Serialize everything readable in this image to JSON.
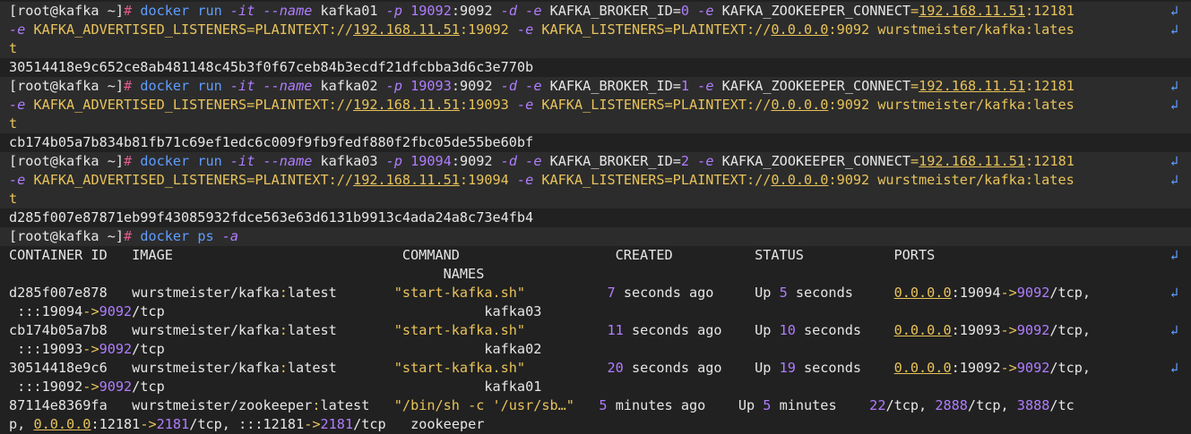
{
  "colors": {
    "background": "#212121",
    "band": "#2c2c2c",
    "text": "#e6e6e6",
    "prompt_hash": "#e05a8a",
    "command": "#5f9cff",
    "option": "#b07dff",
    "string": "#e8c35a"
  },
  "wrap_icon": "↲",
  "lines": [
    {
      "band": true,
      "wrap": true,
      "segments": [
        {
          "t": "[root@kafka ~]",
          "c": "prompt"
        },
        {
          "t": "# ",
          "c": "hash"
        },
        {
          "t": "docker run ",
          "c": "cmd"
        },
        {
          "t": "-it",
          "c": "opt"
        },
        {
          "t": " ",
          "c": "plain"
        },
        {
          "t": "--name",
          "c": "opt"
        },
        {
          "t": " kafka01 ",
          "c": "plain"
        },
        {
          "t": "-p",
          "c": "opt"
        },
        {
          "t": " ",
          "c": "plain"
        },
        {
          "t": "19092",
          "c": "num"
        },
        {
          "t": ":9092 ",
          "c": "plain"
        },
        {
          "t": "-d",
          "c": "opt"
        },
        {
          "t": " ",
          "c": "plain"
        },
        {
          "t": "-e",
          "c": "opt"
        },
        {
          "t": " KAFKA_BROKER_ID=",
          "c": "plain"
        },
        {
          "t": "0",
          "c": "num"
        },
        {
          "t": " ",
          "c": "plain"
        },
        {
          "t": "-e",
          "c": "opt"
        },
        {
          "t": " KAFKA_ZOOKEEPER_CONNECT",
          "c": "plain"
        },
        {
          "t": "=",
          "c": "op"
        },
        {
          "t": "192.168.11.51",
          "c": "ip"
        },
        {
          "t": ":12181",
          "c": "str"
        }
      ]
    },
    {
      "band": true,
      "wrap": true,
      "segments": [
        {
          "t": "-e",
          "c": "opt"
        },
        {
          "t": " KAFKA_ADVERTISED_LISTENERS=PLAINTEXT://",
          "c": "str"
        },
        {
          "t": "192.168.11.51",
          "c": "ip"
        },
        {
          "t": ":19092 ",
          "c": "str"
        },
        {
          "t": "-e",
          "c": "opt"
        },
        {
          "t": " KAFKA_LISTENERS=PLAINTEXT://",
          "c": "str"
        },
        {
          "t": "0.0.0.0",
          "c": "ip"
        },
        {
          "t": ":9092 wurstmeister/kafka:lates",
          "c": "str"
        }
      ]
    },
    {
      "band": true,
      "wrap": false,
      "segments": [
        {
          "t": "t",
          "c": "str"
        }
      ]
    },
    {
      "band": false,
      "wrap": false,
      "segments": [
        {
          "t": "30514418e9c652ce8ab481148c45b3f0f67ceb84b3ecdf21dfcbba3d6c3e770b",
          "c": "plain"
        }
      ]
    },
    {
      "band": true,
      "wrap": true,
      "segments": [
        {
          "t": "[root@kafka ~]",
          "c": "prompt"
        },
        {
          "t": "# ",
          "c": "hash"
        },
        {
          "t": "docker run ",
          "c": "cmd"
        },
        {
          "t": "-it",
          "c": "opt"
        },
        {
          "t": " ",
          "c": "plain"
        },
        {
          "t": "--name",
          "c": "opt"
        },
        {
          "t": " kafka02 ",
          "c": "plain"
        },
        {
          "t": "-p",
          "c": "opt"
        },
        {
          "t": " ",
          "c": "plain"
        },
        {
          "t": "19093",
          "c": "num"
        },
        {
          "t": ":9092 ",
          "c": "plain"
        },
        {
          "t": "-d",
          "c": "opt"
        },
        {
          "t": " ",
          "c": "plain"
        },
        {
          "t": "-e",
          "c": "opt"
        },
        {
          "t": " KAFKA_BROKER_ID=",
          "c": "plain"
        },
        {
          "t": "1",
          "c": "num"
        },
        {
          "t": " ",
          "c": "plain"
        },
        {
          "t": "-e",
          "c": "opt"
        },
        {
          "t": " KAFKA_ZOOKEEPER_CONNECT",
          "c": "plain"
        },
        {
          "t": "=",
          "c": "op"
        },
        {
          "t": "192.168.11.51",
          "c": "ip"
        },
        {
          "t": ":12181",
          "c": "str"
        }
      ]
    },
    {
      "band": true,
      "wrap": true,
      "segments": [
        {
          "t": "-e",
          "c": "opt"
        },
        {
          "t": " KAFKA_ADVERTISED_LISTENERS=PLAINTEXT://",
          "c": "str"
        },
        {
          "t": "192.168.11.51",
          "c": "ip"
        },
        {
          "t": ":19093 ",
          "c": "str"
        },
        {
          "t": "-e",
          "c": "opt"
        },
        {
          "t": " KAFKA_LISTENERS=PLAINTEXT://",
          "c": "str"
        },
        {
          "t": "0.0.0.0",
          "c": "ip"
        },
        {
          "t": ":9092 wurstmeister/kafka:lates",
          "c": "str"
        }
      ]
    },
    {
      "band": true,
      "wrap": false,
      "segments": [
        {
          "t": "t",
          "c": "str"
        }
      ]
    },
    {
      "band": false,
      "wrap": false,
      "segments": [
        {
          "t": "cb174b05a7b834b81fb71c69ef1edc6c009f9fb9fedf880f2fbc05de55be60bf",
          "c": "plain"
        }
      ]
    },
    {
      "band": true,
      "wrap": true,
      "segments": [
        {
          "t": "[root@kafka ~]",
          "c": "prompt"
        },
        {
          "t": "# ",
          "c": "hash"
        },
        {
          "t": "docker run ",
          "c": "cmd"
        },
        {
          "t": "-it",
          "c": "opt"
        },
        {
          "t": " ",
          "c": "plain"
        },
        {
          "t": "--name",
          "c": "opt"
        },
        {
          "t": " kafka03 ",
          "c": "plain"
        },
        {
          "t": "-p",
          "c": "opt"
        },
        {
          "t": " ",
          "c": "plain"
        },
        {
          "t": "19094",
          "c": "num"
        },
        {
          "t": ":9092 ",
          "c": "plain"
        },
        {
          "t": "-d",
          "c": "opt"
        },
        {
          "t": " ",
          "c": "plain"
        },
        {
          "t": "-e",
          "c": "opt"
        },
        {
          "t": " KAFKA_BROKER_ID=",
          "c": "plain"
        },
        {
          "t": "2",
          "c": "num"
        },
        {
          "t": " ",
          "c": "plain"
        },
        {
          "t": "-e",
          "c": "opt"
        },
        {
          "t": " KAFKA_ZOOKEEPER_CONNECT",
          "c": "plain"
        },
        {
          "t": "=",
          "c": "op"
        },
        {
          "t": "192.168.11.51",
          "c": "ip"
        },
        {
          "t": ":12181",
          "c": "str"
        }
      ]
    },
    {
      "band": true,
      "wrap": true,
      "segments": [
        {
          "t": "-e",
          "c": "opt"
        },
        {
          "t": " KAFKA_ADVERTISED_LISTENERS=PLAINTEXT://",
          "c": "str"
        },
        {
          "t": "192.168.11.51",
          "c": "ip"
        },
        {
          "t": ":19094 ",
          "c": "str"
        },
        {
          "t": "-e",
          "c": "opt"
        },
        {
          "t": " KAFKA_LISTENERS=PLAINTEXT://",
          "c": "str"
        },
        {
          "t": "0.0.0.0",
          "c": "ip"
        },
        {
          "t": ":9092 wurstmeister/kafka:lates",
          "c": "str"
        }
      ]
    },
    {
      "band": true,
      "wrap": false,
      "segments": [
        {
          "t": "t",
          "c": "str"
        }
      ]
    },
    {
      "band": false,
      "wrap": false,
      "segments": [
        {
          "t": "d285f007e87871eb99f43085932fdce563e63d6131b9913c4ada24a8c73e4fb4",
          "c": "plain"
        }
      ]
    },
    {
      "band": true,
      "wrap": false,
      "segments": [
        {
          "t": "[root@kafka ~]",
          "c": "prompt"
        },
        {
          "t": "# ",
          "c": "hash"
        },
        {
          "t": "docker ps ",
          "c": "cmd"
        },
        {
          "t": "-a",
          "c": "opt"
        }
      ]
    },
    {
      "band": false,
      "wrap": true,
      "segments": [
        {
          "t": "CONTAINER ID   IMAGE                            COMMAND                   CREATED          STATUS           PORTS",
          "c": "plain"
        }
      ]
    },
    {
      "band": false,
      "wrap": false,
      "segments": [
        {
          "t": "                                                     NAMES",
          "c": "plain"
        }
      ]
    },
    {
      "band": false,
      "wrap": true,
      "segments": [
        {
          "t": "d285f007e878   wurstmeister/kafka",
          "c": "plain"
        },
        {
          "t": ":",
          "c": "str"
        },
        {
          "t": "latest       ",
          "c": "plain"
        },
        {
          "t": "\"start-kafka.sh\"",
          "c": "str"
        },
        {
          "t": "          ",
          "c": "plain"
        },
        {
          "t": "7",
          "c": "num"
        },
        {
          "t": " seconds ago     Up ",
          "c": "plain"
        },
        {
          "t": "5",
          "c": "num"
        },
        {
          "t": " seconds     ",
          "c": "plain"
        },
        {
          "t": "0.0.0.0",
          "c": "ip"
        },
        {
          "t": ":19094",
          "c": "plain"
        },
        {
          "t": "->",
          "c": "op"
        },
        {
          "t": "9092",
          "c": "num"
        },
        {
          "t": "/tcp,",
          "c": "plain"
        }
      ]
    },
    {
      "band": false,
      "wrap": false,
      "segments": [
        {
          "t": " :::19094",
          "c": "plain"
        },
        {
          "t": "->",
          "c": "op"
        },
        {
          "t": "9092",
          "c": "num"
        },
        {
          "t": "/tcp                                       kafka03",
          "c": "plain"
        }
      ]
    },
    {
      "band": false,
      "wrap": true,
      "segments": [
        {
          "t": "cb174b05a7b8   wurstmeister/kafka",
          "c": "plain"
        },
        {
          "t": ":",
          "c": "str"
        },
        {
          "t": "latest       ",
          "c": "plain"
        },
        {
          "t": "\"start-kafka.sh\"",
          "c": "str"
        },
        {
          "t": "          ",
          "c": "plain"
        },
        {
          "t": "11",
          "c": "num"
        },
        {
          "t": " seconds ago    Up ",
          "c": "plain"
        },
        {
          "t": "10",
          "c": "num"
        },
        {
          "t": " seconds    ",
          "c": "plain"
        },
        {
          "t": "0.0.0.0",
          "c": "ip"
        },
        {
          "t": ":19093",
          "c": "plain"
        },
        {
          "t": "->",
          "c": "op"
        },
        {
          "t": "9092",
          "c": "num"
        },
        {
          "t": "/tcp,",
          "c": "plain"
        }
      ]
    },
    {
      "band": false,
      "wrap": false,
      "segments": [
        {
          "t": " :::19093",
          "c": "plain"
        },
        {
          "t": "->",
          "c": "op"
        },
        {
          "t": "9092",
          "c": "num"
        },
        {
          "t": "/tcp                                       kafka02",
          "c": "plain"
        }
      ]
    },
    {
      "band": false,
      "wrap": true,
      "segments": [
        {
          "t": "30514418e9c6   wurstmeister/kafka",
          "c": "plain"
        },
        {
          "t": ":",
          "c": "str"
        },
        {
          "t": "latest       ",
          "c": "plain"
        },
        {
          "t": "\"start-kafka.sh\"",
          "c": "str"
        },
        {
          "t": "          ",
          "c": "plain"
        },
        {
          "t": "20",
          "c": "num"
        },
        {
          "t": " seconds ago    Up ",
          "c": "plain"
        },
        {
          "t": "19",
          "c": "num"
        },
        {
          "t": " seconds    ",
          "c": "plain"
        },
        {
          "t": "0.0.0.0",
          "c": "ip"
        },
        {
          "t": ":19092",
          "c": "plain"
        },
        {
          "t": "->",
          "c": "op"
        },
        {
          "t": "9092",
          "c": "num"
        },
        {
          "t": "/tcp,",
          "c": "plain"
        }
      ]
    },
    {
      "band": false,
      "wrap": false,
      "segments": [
        {
          "t": " :::19092",
          "c": "plain"
        },
        {
          "t": "->",
          "c": "op"
        },
        {
          "t": "9092",
          "c": "num"
        },
        {
          "t": "/tcp                                       kafka01",
          "c": "plain"
        }
      ]
    },
    {
      "band": false,
      "wrap": false,
      "segments": [
        {
          "t": "87114e8369fa   wurstmeister/zookeeper",
          "c": "plain"
        },
        {
          "t": ":",
          "c": "str"
        },
        {
          "t": "latest   ",
          "c": "plain"
        },
        {
          "t": "\"/bin/sh -c '/usr/sb…\"",
          "c": "str"
        },
        {
          "t": "   ",
          "c": "plain"
        },
        {
          "t": "5",
          "c": "num"
        },
        {
          "t": " minutes ago    Up ",
          "c": "plain"
        },
        {
          "t": "5",
          "c": "num"
        },
        {
          "t": " minutes    ",
          "c": "plain"
        },
        {
          "t": "22",
          "c": "num"
        },
        {
          "t": "/tcp, ",
          "c": "plain"
        },
        {
          "t": "2888",
          "c": "num"
        },
        {
          "t": "/tcp, ",
          "c": "plain"
        },
        {
          "t": "3888",
          "c": "num"
        },
        {
          "t": "/tc",
          "c": "plain"
        }
      ]
    },
    {
      "band": false,
      "wrap": false,
      "segments": [
        {
          "t": "p, ",
          "c": "plain"
        },
        {
          "t": "0.0.0.0",
          "c": "ip"
        },
        {
          "t": ":12181",
          "c": "plain"
        },
        {
          "t": "->",
          "c": "op"
        },
        {
          "t": "2181",
          "c": "num"
        },
        {
          "t": "/tcp, :::12181",
          "c": "plain"
        },
        {
          "t": "->",
          "c": "op"
        },
        {
          "t": "2181",
          "c": "num"
        },
        {
          "t": "/tcp   zookeeper",
          "c": "plain"
        }
      ]
    }
  ]
}
